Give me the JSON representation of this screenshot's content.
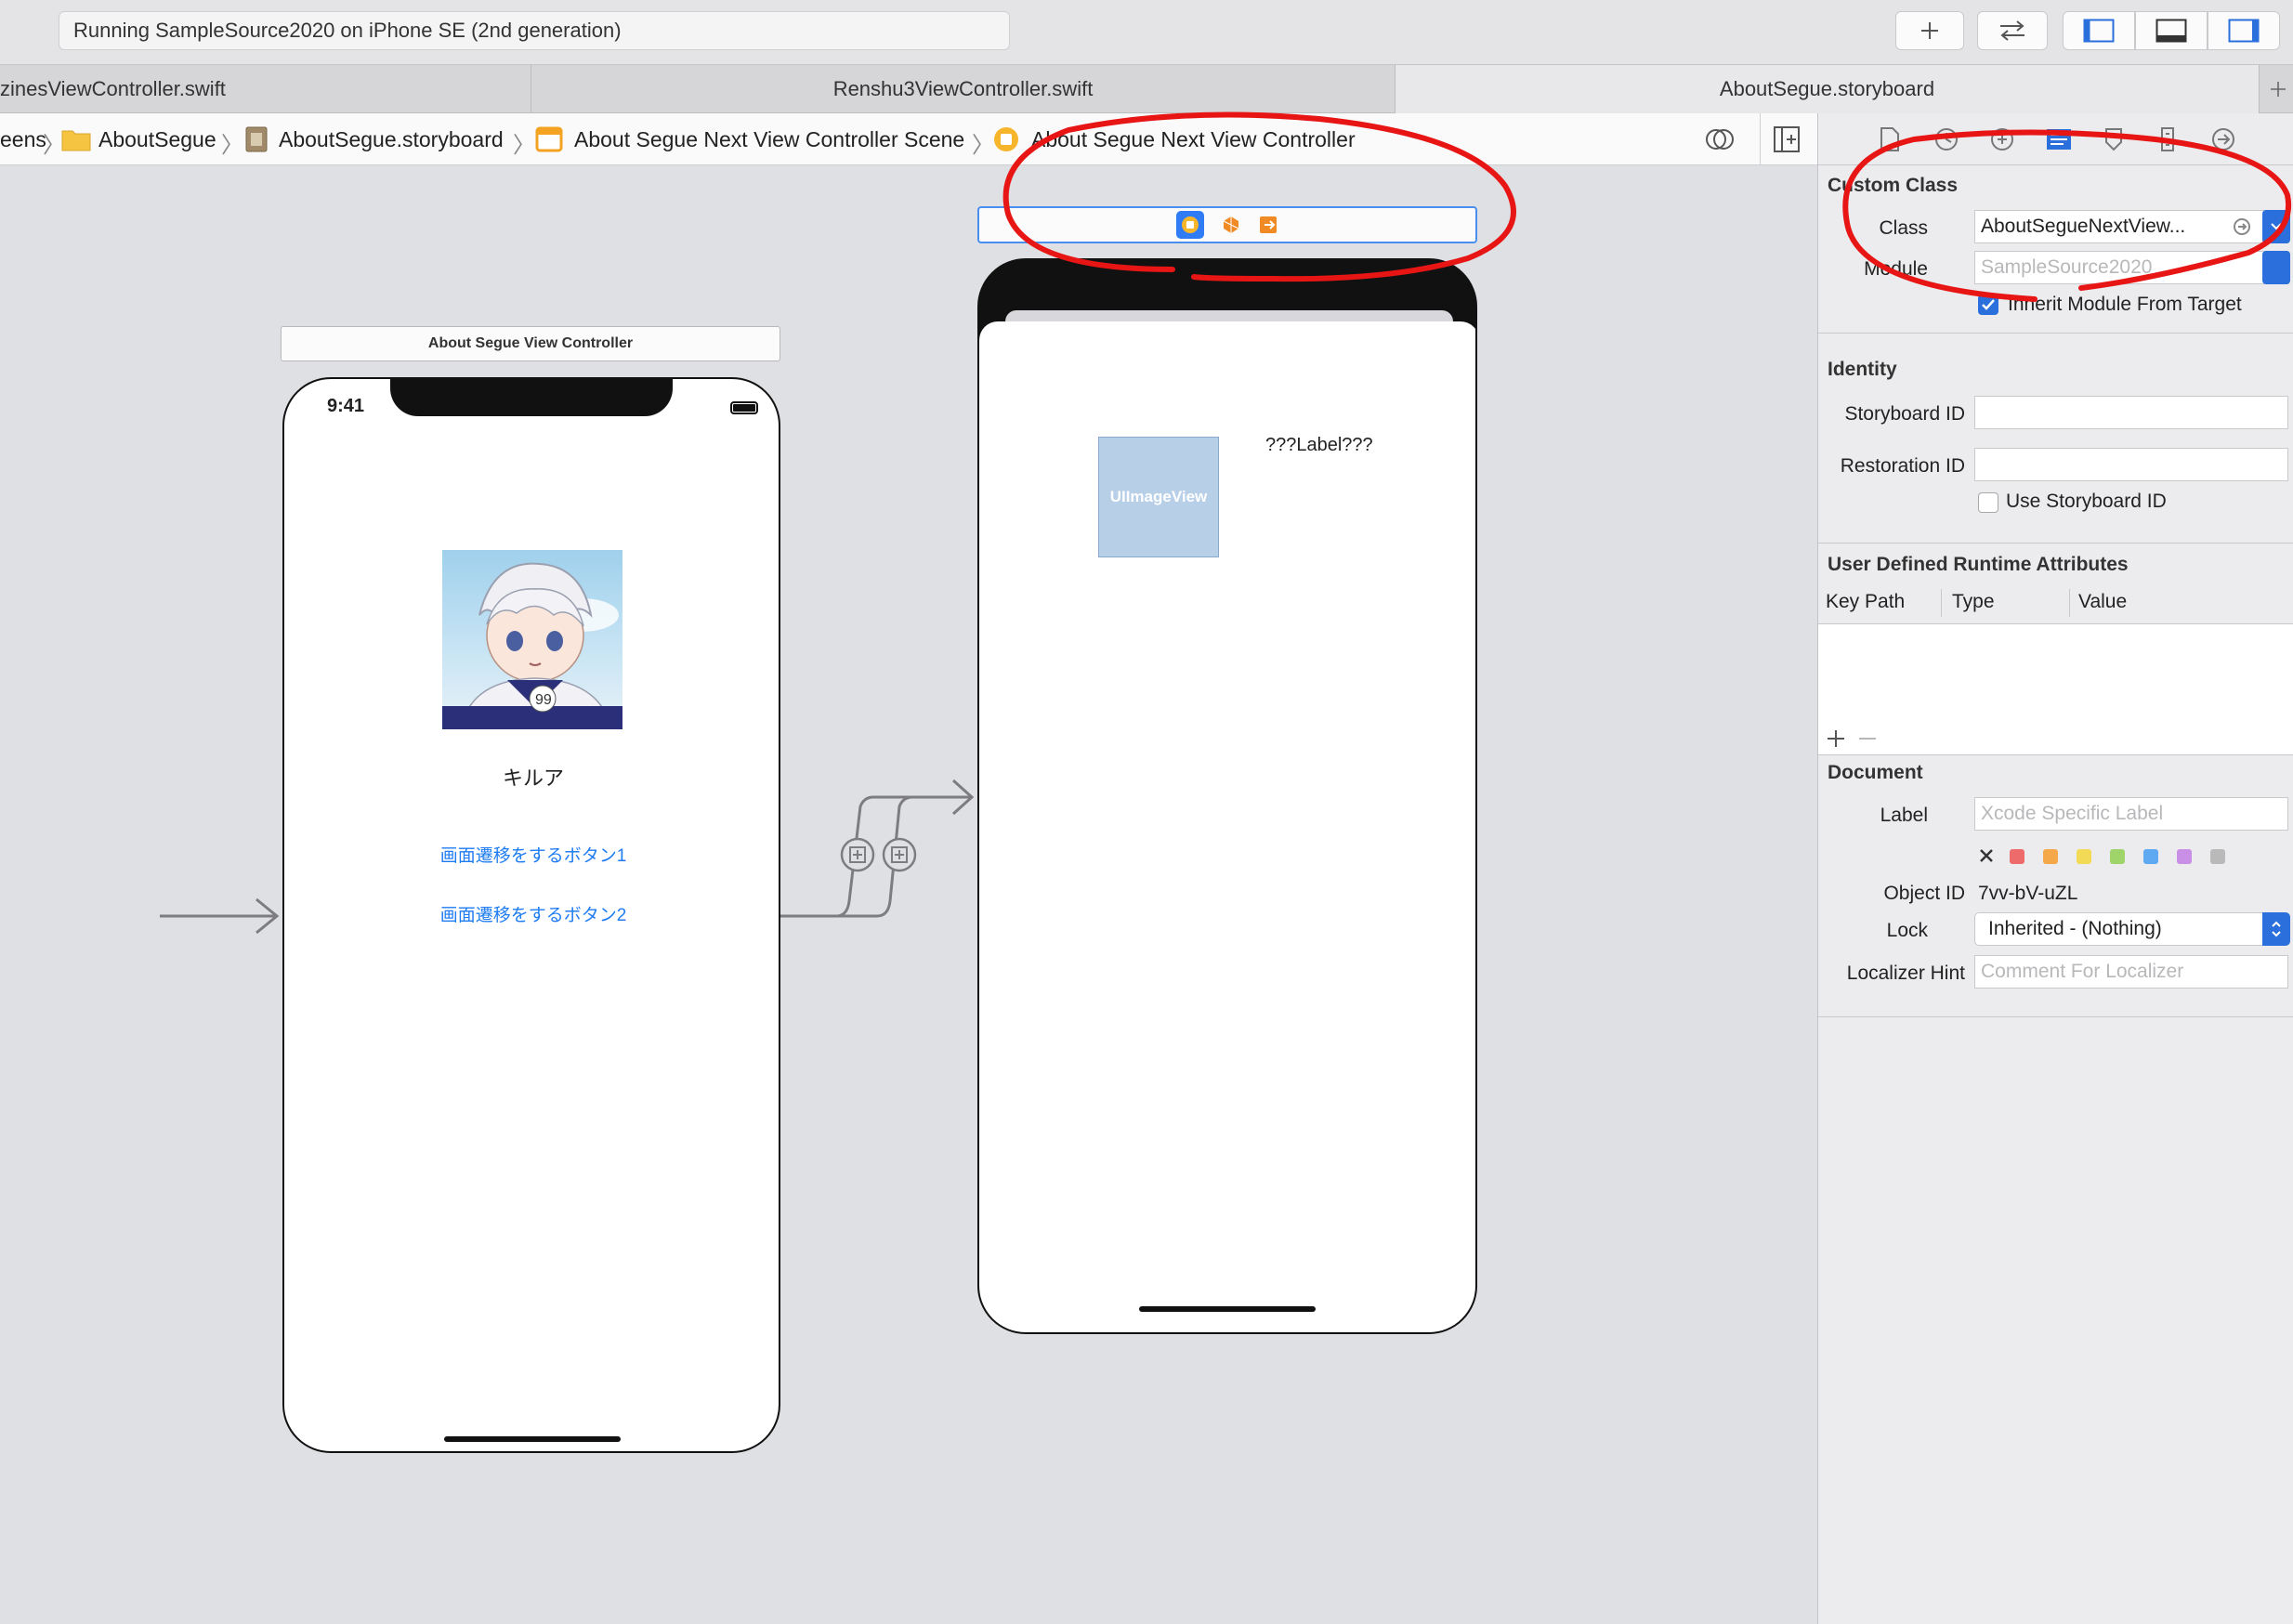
{
  "toolbar": {
    "activity_status": "Running SampleSource2020 on iPhone SE (2nd generation)",
    "add_icon": "plus-icon",
    "swap_icon": "swap-arrows-icon",
    "layout_icons": [
      "navigator-panel-icon",
      "debug-panel-icon",
      "inspector-panel-icon"
    ]
  },
  "tabs": [
    {
      "label": "zinesViewController.swift",
      "active": false
    },
    {
      "label": "Renshu3ViewController.swift",
      "active": false
    },
    {
      "label": "AboutSegue.storyboard",
      "active": true
    }
  ],
  "jumpbar": {
    "items": [
      "eens",
      "AboutSegue",
      "AboutSegue.storyboard",
      "About Segue Next View Controller Scene",
      "About Segue Next View Controller"
    ]
  },
  "canvas": {
    "scene1": {
      "title": "About Segue View Controller",
      "time": "9:41",
      "character_name": "キルア",
      "button1": "画面遷移をするボタン1",
      "button2": "画面遷移をするボタン2"
    },
    "scene2": {
      "image_placeholder": "UIImageView",
      "label": "???Label???"
    }
  },
  "inspector": {
    "custom_class": {
      "title": "Custom Class",
      "class_label": "Class",
      "class_value": "AboutSegueNextView...",
      "module_label": "Module",
      "module_placeholder": "SampleSource2020",
      "inherit_label": "Inherit Module From Target",
      "inherit_checked": true
    },
    "identity": {
      "title": "Identity",
      "storyboard_id_label": "Storyboard ID",
      "restoration_id_label": "Restoration ID",
      "use_storyboard_id_label": "Use Storyboard ID"
    },
    "runtime_attributes": {
      "title": "User Defined Runtime Attributes",
      "columns": [
        "Key Path",
        "Type",
        "Value"
      ]
    },
    "document": {
      "title": "Document",
      "label_label": "Label",
      "label_placeholder": "Xcode Specific Label",
      "object_id_label": "Object ID",
      "object_id_value": "7vv-bV-uZL",
      "lock_label": "Lock",
      "lock_value": "Inherited - (Nothing)",
      "localizer_hint_label": "Localizer Hint",
      "localizer_hint_placeholder": "Comment For Localizer"
    },
    "label_colors": [
      "#ee6b6b",
      "#f5a849",
      "#f2da57",
      "#9fd46b",
      "#5fa8f2",
      "#c98ee6",
      "#b9b9b9"
    ]
  },
  "annotation_color": "#e81515"
}
